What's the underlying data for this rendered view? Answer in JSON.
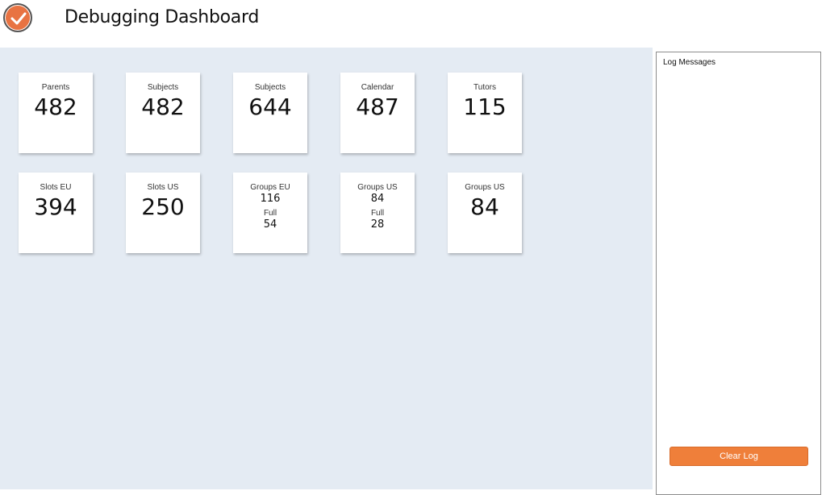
{
  "header": {
    "title": "Debugging Dashboard",
    "logo_icon": "check-circle-icon",
    "logo_color": "#e87342"
  },
  "cards": [
    {
      "label": "Parents",
      "value": "482"
    },
    {
      "label": "Subjects",
      "value": "482"
    },
    {
      "label": "Subjects",
      "value": "644"
    },
    {
      "label": "Calendar",
      "value": "487"
    },
    {
      "label": "Tutors",
      "value": "115"
    },
    {
      "label": "Slots EU",
      "value": "394"
    },
    {
      "label": "Slots US",
      "value": "250"
    },
    {
      "label": "Groups EU",
      "value": "116",
      "sub_label": "Full",
      "sub_value": "54"
    },
    {
      "label": "Groups US",
      "value": "84",
      "sub_label": "Full",
      "sub_value": "28"
    },
    {
      "label": "Groups US",
      "value": "84"
    }
  ],
  "log": {
    "title": "Log Messages",
    "clear_label": "Clear Log",
    "button_color": "#ef7f3a"
  },
  "colors": {
    "main_background": "#e4ebf3",
    "card_background": "#ffffff"
  }
}
